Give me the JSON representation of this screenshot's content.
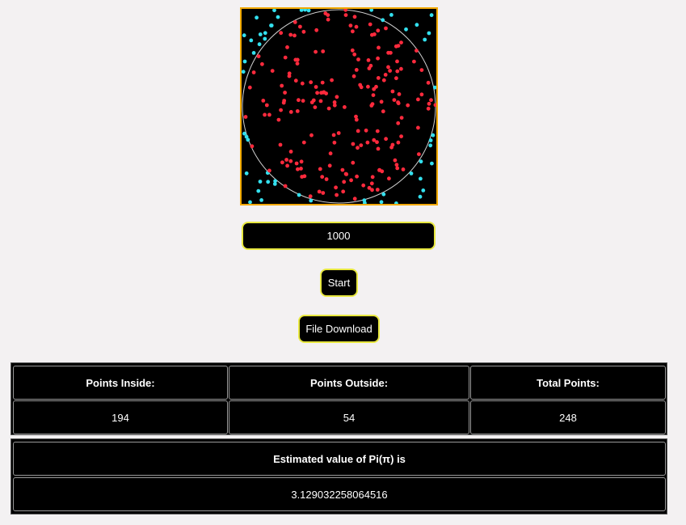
{
  "simulation": {
    "circle_color": "#cfcfcf",
    "inside_color": "#ff2a3d",
    "outside_color": "#33e0ee",
    "canvas_bg": "#000000",
    "canvas_border": "#f2a900"
  },
  "controls": {
    "points_input_value": "1000",
    "start_label": "Start",
    "download_label": "File Download"
  },
  "results": {
    "headers": [
      "Points Inside:",
      "Points Outside:",
      "Total Points:"
    ],
    "values": [
      "194",
      "54",
      "248"
    ],
    "pi_label": "Estimated value of Pi(π) is",
    "pi_value": "3.129032258064516"
  }
}
